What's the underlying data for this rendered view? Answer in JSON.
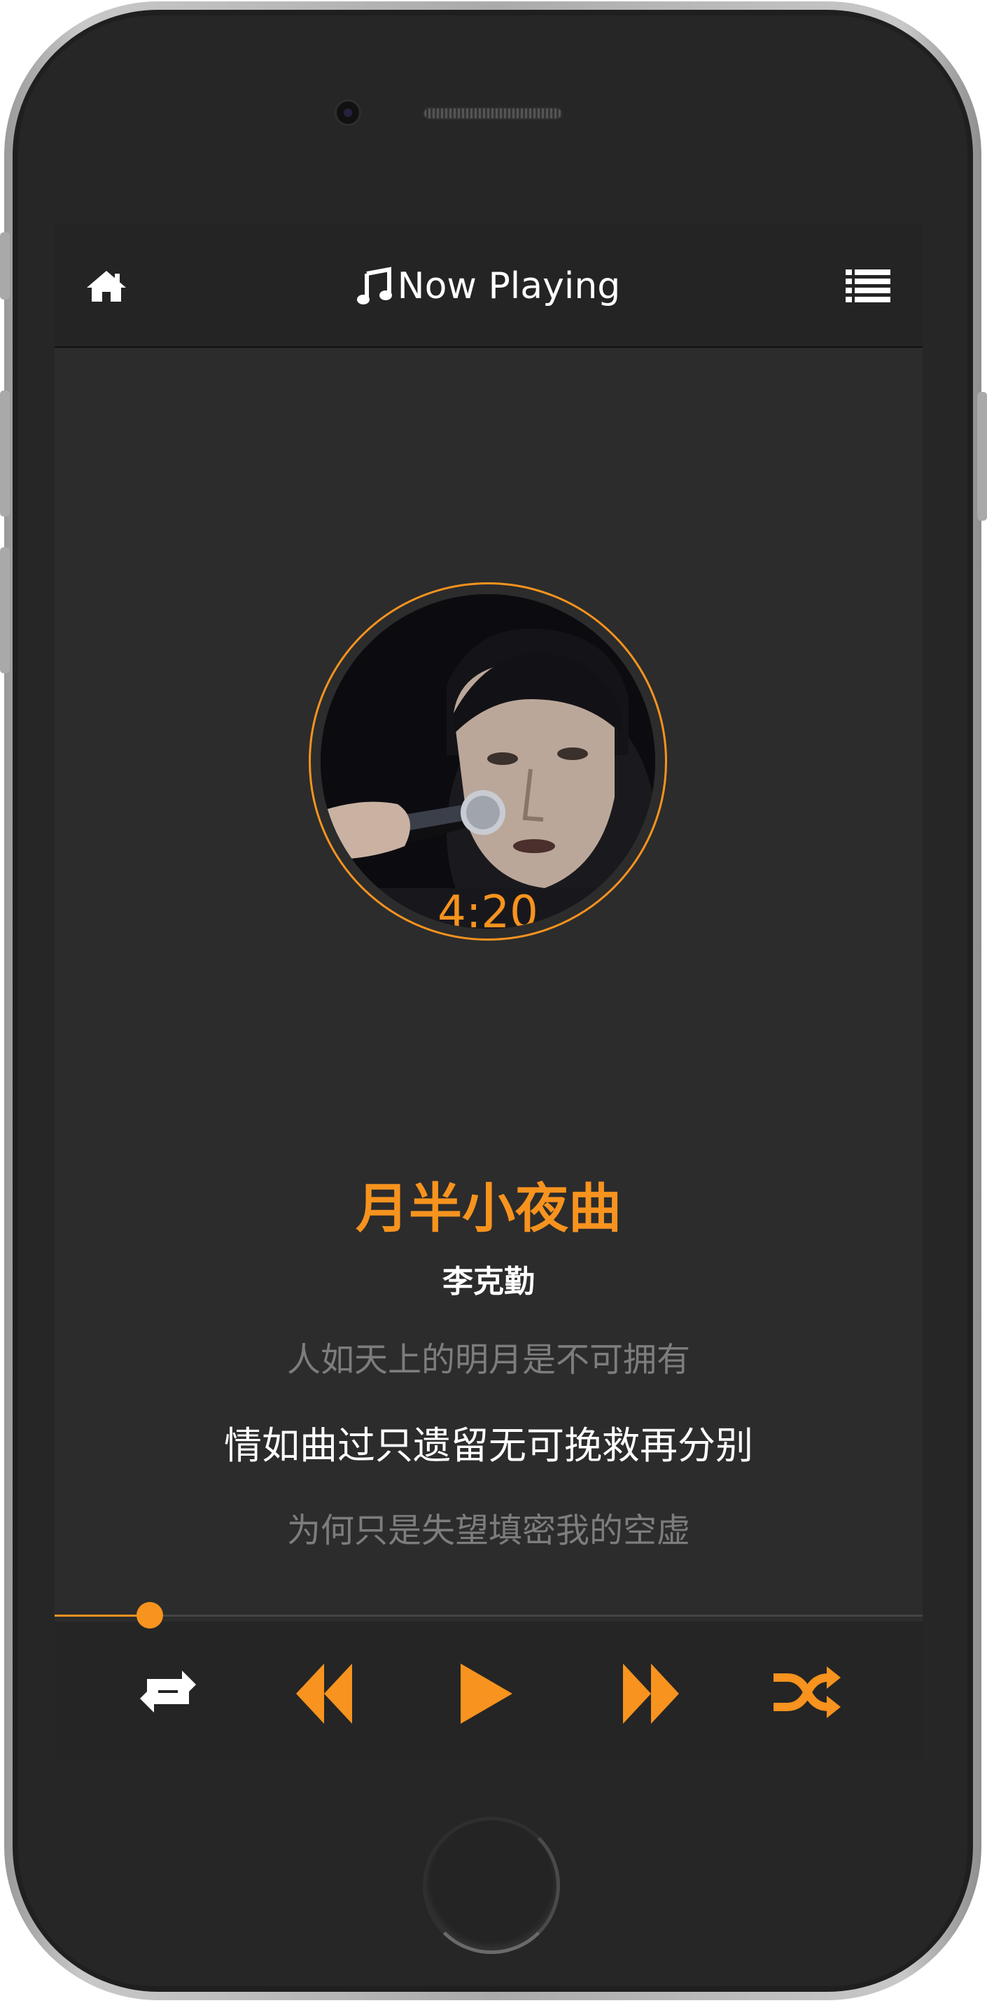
{
  "header": {
    "title": "Now Playing"
  },
  "player": {
    "time": "4:20",
    "song_title": "月半小夜曲",
    "artist": "李克勤",
    "progress": 0.11
  },
  "lyrics": {
    "previous": "人如天上的明月是不可拥有",
    "current": "情如曲过只遗留无可挽救再分别",
    "next": "为何只是失望填密我的空虚"
  },
  "icons": {
    "home": "home-icon",
    "menu": "list-icon",
    "music": "music-note-icon",
    "repeat": "repeat-icon",
    "rewind": "rewind-icon",
    "play": "play-icon",
    "forward": "fast-forward-icon",
    "shuffle": "shuffle-icon"
  },
  "colors": {
    "accent": "#f7931e",
    "background": "#2c2c2c",
    "header": "#242424"
  }
}
